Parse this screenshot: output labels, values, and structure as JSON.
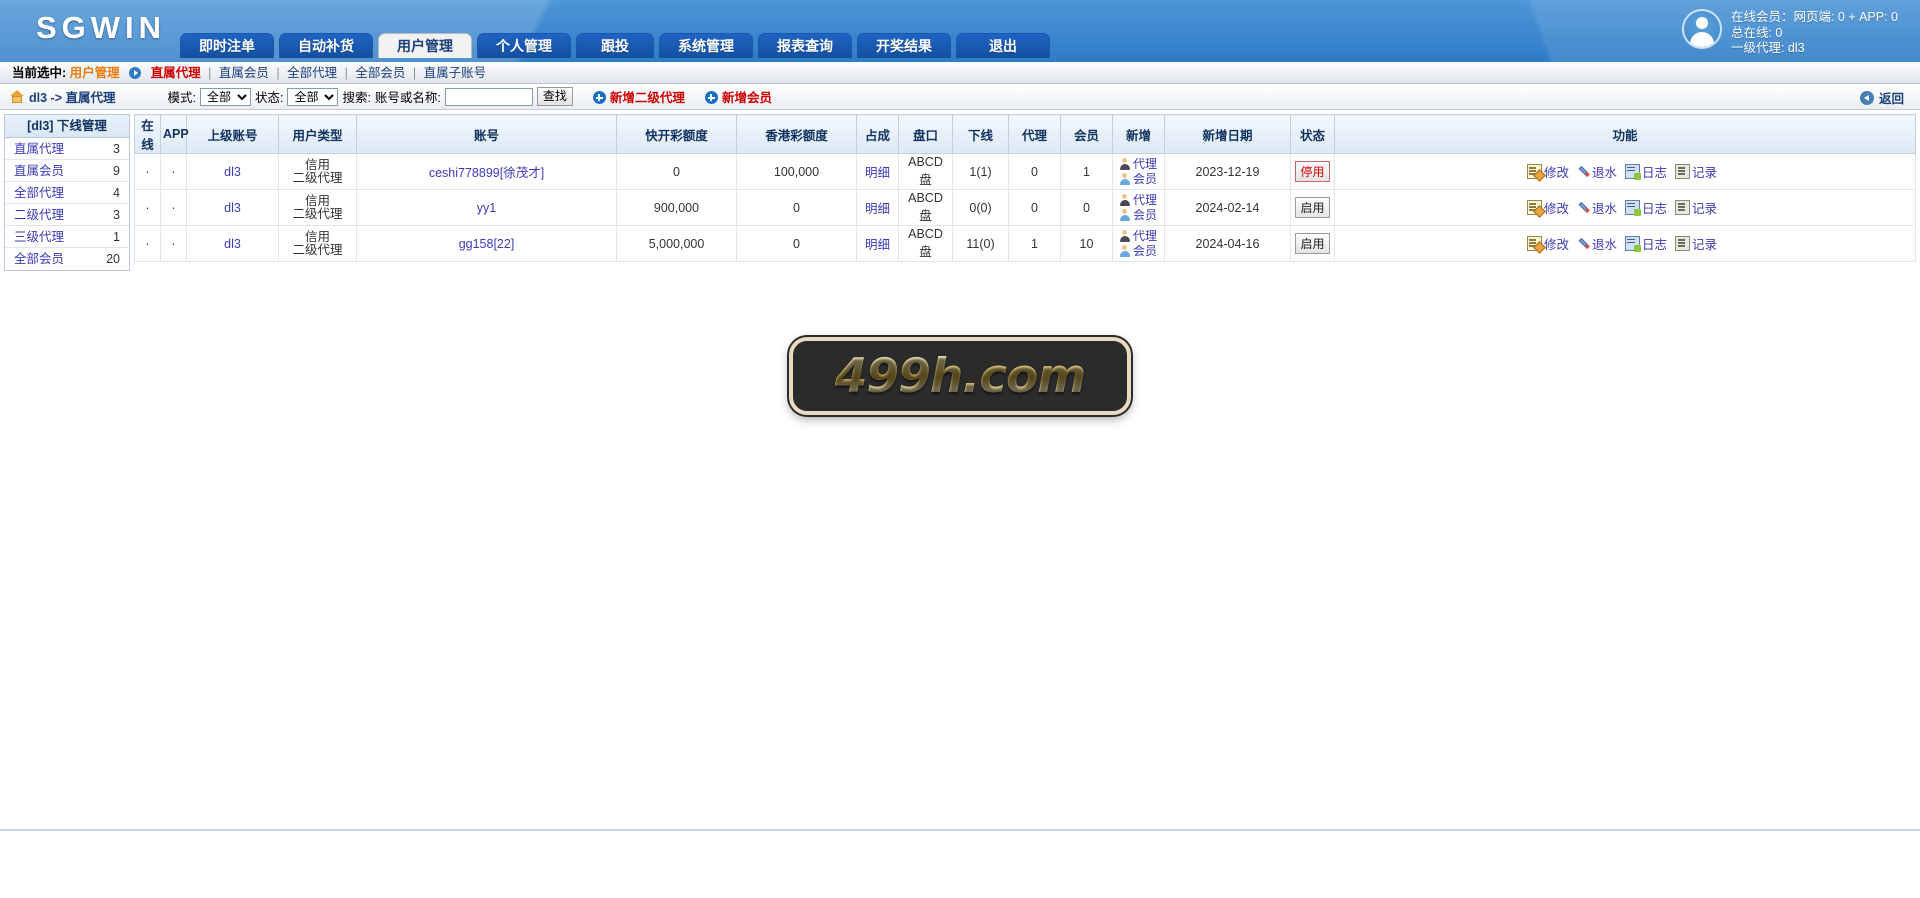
{
  "header": {
    "brand": "SGWIN",
    "tabs": [
      {
        "label": "即时注单",
        "active": false
      },
      {
        "label": "自动补货",
        "active": false
      },
      {
        "label": "用户管理",
        "active": true
      },
      {
        "label": "个人管理",
        "active": false
      },
      {
        "label": "跟投",
        "active": false
      },
      {
        "label": "系统管理",
        "active": false
      },
      {
        "label": "报表查询",
        "active": false
      },
      {
        "label": "开奖结果",
        "active": false
      },
      {
        "label": "退出",
        "active": false
      }
    ],
    "user": {
      "avatar_icon": "user-avatar-icon",
      "line1": "在线会员：网页端: 0 + APP: 0",
      "line2": "总在线: 0",
      "line3": "一级代理: dl3"
    }
  },
  "subnav": {
    "prefix": "当前选中:",
    "current_module": "用户管理",
    "arrow_icon": "arrow-right-circle-icon",
    "active_item": "直属代理",
    "items": [
      "直属会员",
      "全部代理",
      "全部会员",
      "直属子账号"
    ],
    "separator": "|"
  },
  "toolbar": {
    "home_icon": "home-icon",
    "breadcrumb": "dl3 -> 直属代理",
    "mode_label": "模式:",
    "mode_value": "全部",
    "mode_options": [
      "全部"
    ],
    "status_label": "状态:",
    "status_value": "全部",
    "status_options": [
      "全部"
    ],
    "search_label": "搜索:",
    "search_field_label": "账号或名称:",
    "search_value": "",
    "search_placeholder": "",
    "search_button": "查找",
    "add_agent_label": "新增二级代理",
    "add_member_label": "新增会员",
    "plus_icon": "plus-circle-icon",
    "back_icon": "back-arrow-circle-icon",
    "back_label": "返回"
  },
  "sidebar": {
    "title": "[dl3] 下线管理",
    "items": [
      {
        "label": "直属代理",
        "count": "3"
      },
      {
        "label": "直属会员",
        "count": "9"
      },
      {
        "label": "全部代理",
        "count": "4"
      },
      {
        "label": "二级代理",
        "count": "3"
      },
      {
        "label": "三级代理",
        "count": "1"
      },
      {
        "label": "全部会员",
        "count": "20"
      }
    ]
  },
  "table": {
    "columns": [
      "在线",
      "APP",
      "上级账号",
      "用户类型",
      "账号",
      "快开彩额度",
      "香港彩额度",
      "占成",
      "盘口",
      "下线",
      "代理",
      "会员",
      "新增",
      "新增日期",
      "状态",
      "功能"
    ],
    "row_action_labels": {
      "detail": "明细",
      "new_agent": "代理",
      "new_member": "会员",
      "edit": "修改",
      "rebate": "退水",
      "log": "日志",
      "record": "记录"
    },
    "rows": [
      {
        "online": "·",
        "app": "·",
        "parent": "dl3",
        "user_type_line1": "信用",
        "user_type_line2": "二级代理",
        "account": "ceshi778899[徐茂才]",
        "fast_quota": "0",
        "hk_quota": "100,000",
        "share": "明细",
        "market": "ABCD盘",
        "downline": "1(1)",
        "agents": "0",
        "members": "1",
        "created_date": "2023-12-19",
        "state": "停用",
        "state_disabled": true
      },
      {
        "online": "·",
        "app": "·",
        "parent": "dl3",
        "user_type_line1": "信用",
        "user_type_line2": "二级代理",
        "account": "yy1",
        "fast_quota": "900,000",
        "hk_quota": "0",
        "share": "明细",
        "market": "ABCD盘",
        "downline": "0(0)",
        "agents": "0",
        "members": "0",
        "created_date": "2024-02-14",
        "state": "启用",
        "state_disabled": false
      },
      {
        "online": "·",
        "app": "·",
        "parent": "dl3",
        "user_type_line1": "信用",
        "user_type_line2": "二级代理",
        "account": "gg158[22]",
        "fast_quota": "5,000,000",
        "hk_quota": "0",
        "share": "明细",
        "market": "ABCD盘",
        "downline": "11(0)",
        "agents": "1",
        "members": "10",
        "created_date": "2024-04-16",
        "state": "启用",
        "state_disabled": false
      }
    ]
  },
  "watermark": {
    "text": "499h.com"
  },
  "colors": {
    "header_blue": "#3f8ad0",
    "tab_blue": "#14509f",
    "link_purple": "#3b3bb5",
    "accent_red": "#d00000",
    "accent_orange": "#e87d0d",
    "header_text_navy": "#12325e"
  }
}
